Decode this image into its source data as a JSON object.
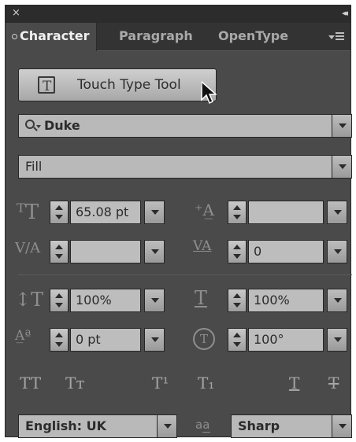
{
  "panel": {
    "close_glyph": "×",
    "collapse_glyph": "◂◂"
  },
  "tabs": [
    {
      "label": "Character",
      "active": true
    },
    {
      "label": "Paragraph",
      "active": false
    },
    {
      "label": "OpenType",
      "active": false
    }
  ],
  "touch_type_button": {
    "label": "Touch Type Tool"
  },
  "font_family": {
    "value": "Duke",
    "icon": "search-icon"
  },
  "font_style": {
    "value": "Fill"
  },
  "fields": {
    "font_size": {
      "value": "65.08 pt",
      "icon": "font-size-icon"
    },
    "leading": {
      "value": "",
      "icon": "leading-icon"
    },
    "kerning": {
      "value": "",
      "icon": "kerning-icon"
    },
    "tracking": {
      "value": "0",
      "icon": "tracking-icon"
    },
    "vertical_scale": {
      "value": "100%",
      "icon": "vertical-scale-icon"
    },
    "horizontal_scale": {
      "value": "100%",
      "icon": "horizontal-scale-icon"
    },
    "baseline_shift": {
      "value": "0 pt",
      "icon": "baseline-shift-icon"
    },
    "rotation": {
      "value": "100°",
      "icon": "character-rotation-icon"
    }
  },
  "style_buttons": [
    {
      "name": "all-caps",
      "glyph": "TT"
    },
    {
      "name": "small-caps",
      "glyph": "Tт"
    },
    {
      "name": "superscript",
      "glyph": "T¹"
    },
    {
      "name": "subscript",
      "glyph": "T₁"
    },
    {
      "name": "underline",
      "glyph": "T"
    },
    {
      "name": "strikethrough",
      "glyph": "T"
    }
  ],
  "language": {
    "value": "English: UK"
  },
  "anti_alias": {
    "icon_text": "aa",
    "value": "Sharp"
  },
  "colors": {
    "panel_bg": "#4a4a4a",
    "tab_bar_bg": "#333333",
    "field_bg": "#bdbdbd",
    "text_light": "#e6e6e6"
  }
}
